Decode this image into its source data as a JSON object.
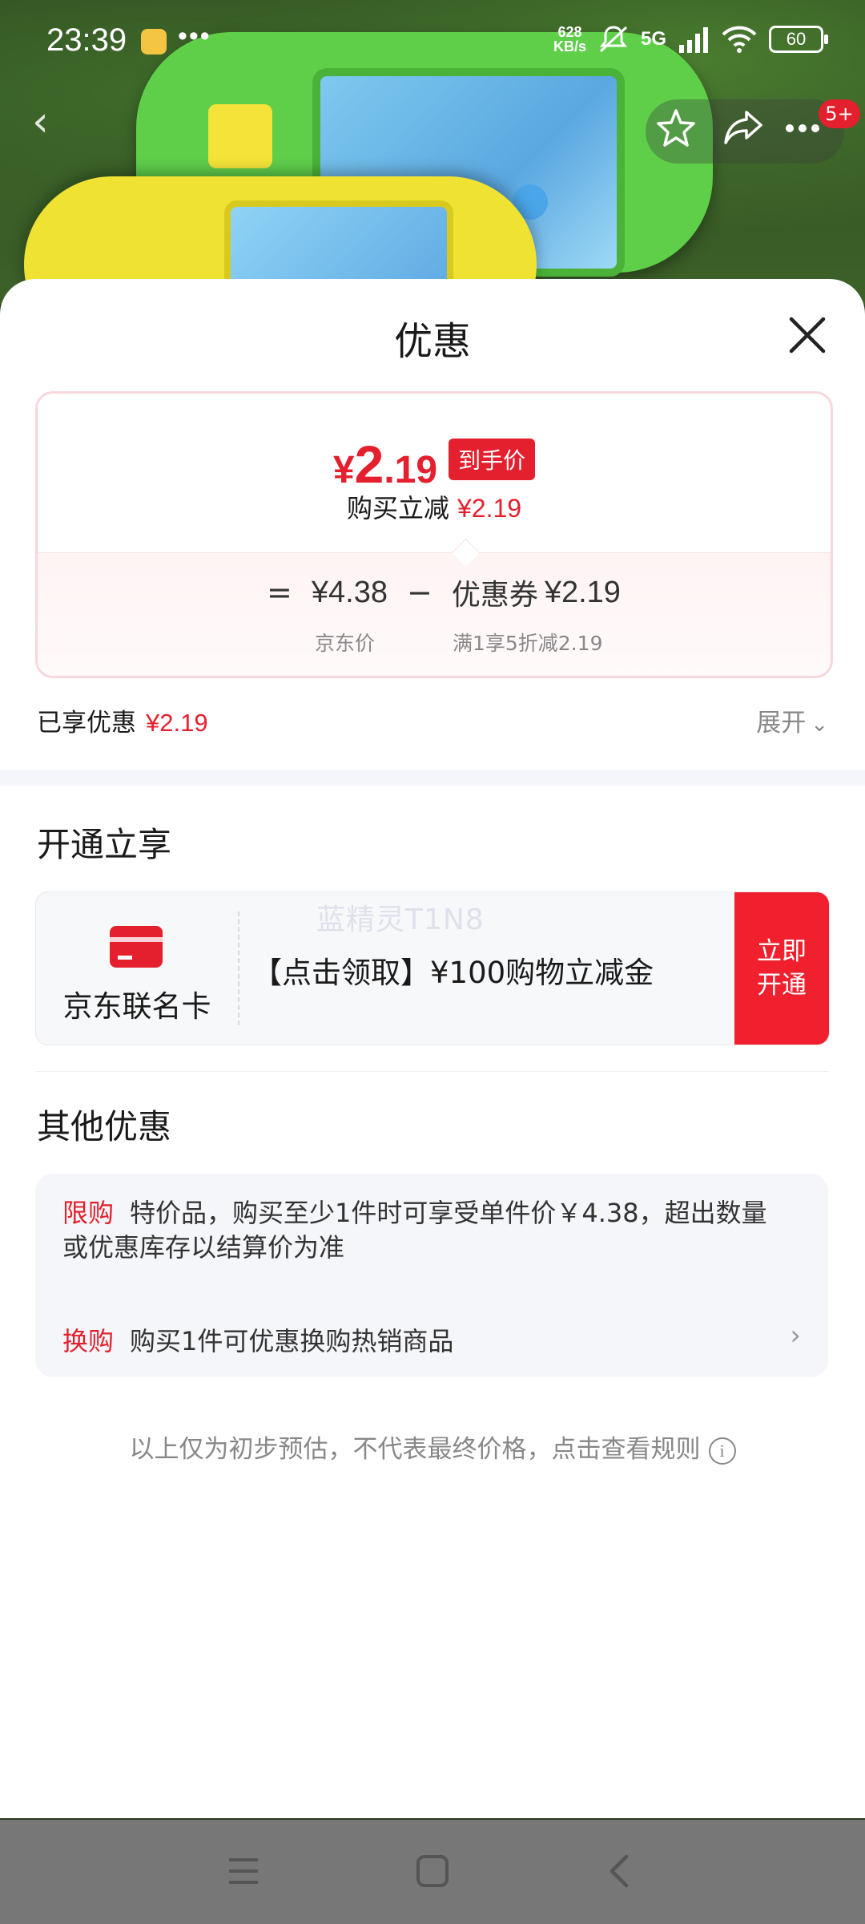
{
  "status_bar": {
    "time": "23:39",
    "dots": "•••",
    "net_speed_value": "628",
    "net_speed_unit": "KB/s",
    "network": "5G",
    "battery": "60"
  },
  "product_nav": {
    "back_icon": "chevron-left-icon",
    "favorite_icon": "star-icon",
    "share_icon": "share-icon",
    "more_icon": "more-icon",
    "badge": "5+"
  },
  "sheet": {
    "title": "优惠",
    "price_summary": {
      "currency": "¥",
      "final_price_integer": "2",
      "final_price_decimal": ".19",
      "final_price_tag": "到手价",
      "instant_discount_label": "购买立减",
      "instant_discount_value": "¥2.19",
      "equals": "=",
      "jd_price": "¥4.38",
      "jd_price_label": "京东价",
      "minus": "−",
      "coupon_label": "优惠券",
      "coupon_value": "¥2.19",
      "coupon_rule": "满1享5折减2.19"
    },
    "enjoyed_label": "已享优惠",
    "enjoyed_value": "¥2.19",
    "expand_label": "展开",
    "open_section": {
      "title": "开通立享",
      "card_name": "京东联名卡",
      "offer_text": "【点击领取】¥100购物立减金",
      "open_button": "立即开通",
      "watermark": "蓝精灵T1N8"
    },
    "other_section": {
      "title": "其他优惠",
      "items": [
        {
          "tag": "限购",
          "text": "特价品，购买至少1件时可享受单件价￥4.38，超出数量或优惠库存以结算价为准"
        },
        {
          "tag": "换购",
          "text": "购买1件可优惠换购热销商品"
        }
      ]
    },
    "footnote": "以上仅为初步预估，不代表最终价格，点击查看规则"
  },
  "colors": {
    "accent_red": "#e4202e",
    "text_primary": "#1a1a1a",
    "text_secondary": "#888888"
  }
}
